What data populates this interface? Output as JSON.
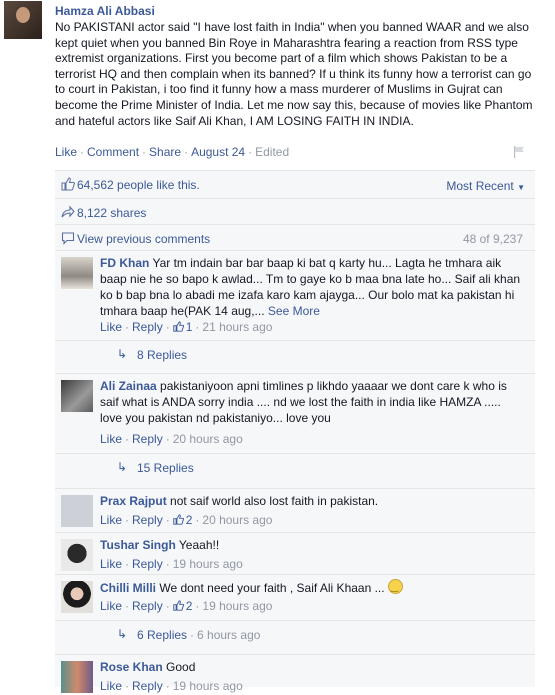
{
  "post": {
    "author": "Hamza Ali Abbasi",
    "text": "No PAKISTANI actor said \"I have lost faith in India\" when you banned WAAR and we also kept quiet when you banned Bin Roye in Maharashtra fearing a reaction from RSS type extremist organizations. First you become part of a film which shows Pakistan to be a terrorist HQ and then complain when its banned? If u think its funny how a terrorist can go to court in Pakistan, i too find it funny how a mass murderer of Muslims in Gujrat can become the Prime Minister of India. Let me now say this, because of movies like Phantom and hateful actors like Saif Ali Khan, I AM LOSING FAITH IN INDIA.",
    "actions": {
      "like": "Like",
      "comment": "Comment",
      "share": "Share",
      "date": "August 24",
      "edited": "Edited"
    }
  },
  "feedback": {
    "likes": "64,562 people like this.",
    "sort": "Most Recent",
    "shares": "8,122 shares",
    "view_previous": "View previous comments",
    "count": "48 of 9,237"
  },
  "comments": [
    {
      "name": "FD Khan",
      "text": "Yar tm indain bar bar baap ki bat q karty hu... Lagta he tmhara aik baap nie he so bapo k awlad... Tm to gaye ko b maa bna late ho... Saif ali khan ko b bap bna lo abadi me izafa karo kam ajayga... Our bolo mat ka pakistan hi tmhara baap he(PAK 14 aug,...",
      "see_more": "See More",
      "like": "Like",
      "reply": "Reply",
      "likes": "1",
      "time": "21 hours ago",
      "replies": "8 Replies"
    },
    {
      "name": "Ali Zainaa",
      "text": "pakistaniyoon apni timlines p likhdo yaaaar we dont care k who is saif what is ANDA sorry india .... nd we lost the faith in india like HAMZA ..... love you pakistan nd pakistaniyo... love you",
      "like": "Like",
      "reply": "Reply",
      "time": "20 hours ago",
      "replies": "15 Replies"
    },
    {
      "name": "Prax Rajput",
      "text": "not saif world also lost faith in pakistan.",
      "like": "Like",
      "reply": "Reply",
      "likes": "2",
      "time": "20 hours ago"
    },
    {
      "name": "Tushar Singh",
      "text": "Yeaah!!",
      "like": "Like",
      "reply": "Reply",
      "time": "19 hours ago"
    },
    {
      "name": "Chilli Milli",
      "text": "We dont need your faith , Saif Ali Khaan ...",
      "like": "Like",
      "reply": "Reply",
      "likes": "2",
      "time": "19 hours ago",
      "replies": "6 Replies",
      "replies_time": "6 hours ago"
    },
    {
      "name": "Rose Khan",
      "text": "Good",
      "like": "Like",
      "reply": "Reply",
      "time": "19 hours ago"
    }
  ],
  "colors": {
    "link": "#3b5998",
    "muted": "#9197a3",
    "panel": "#f6f7f9"
  }
}
